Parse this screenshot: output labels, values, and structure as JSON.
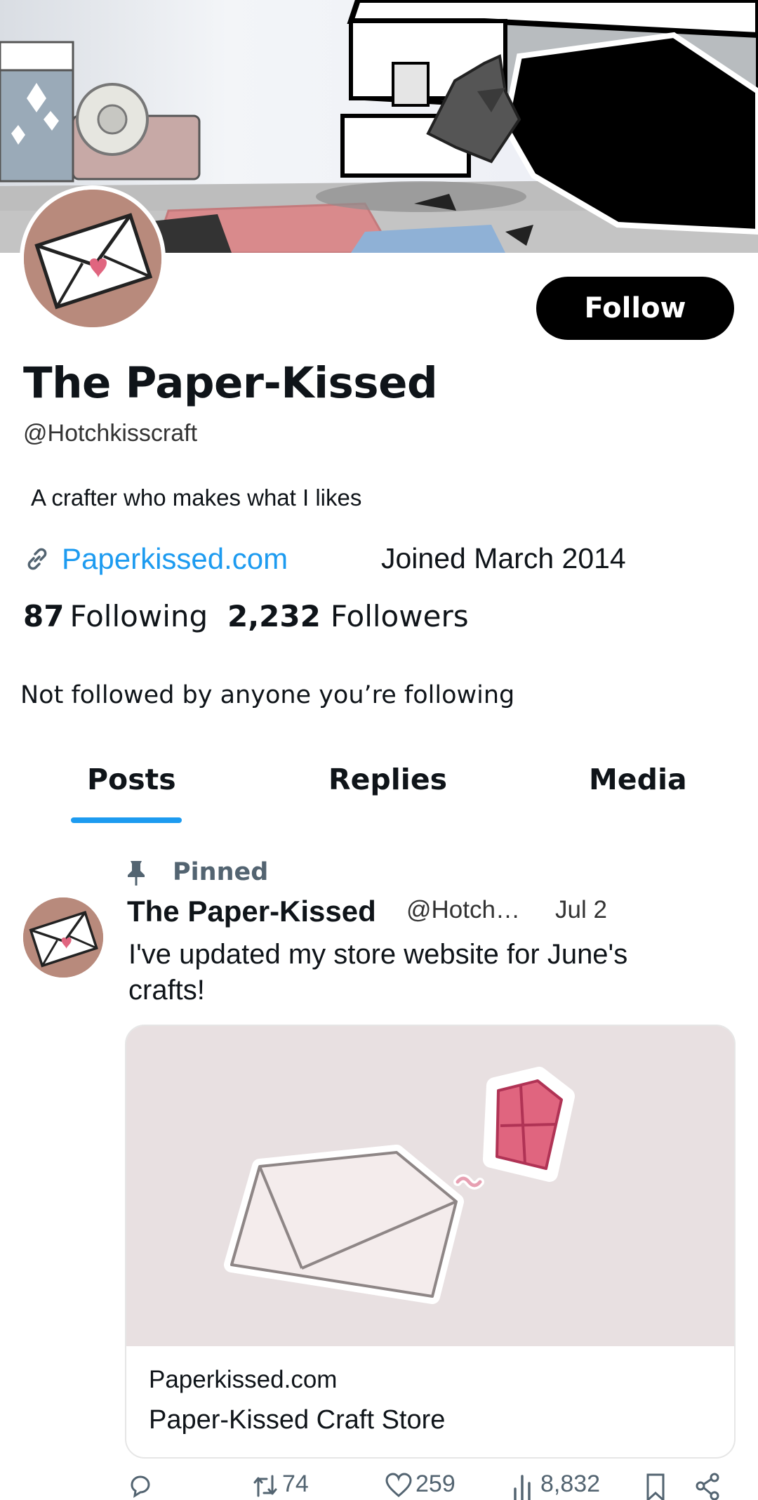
{
  "profile": {
    "display_name": "The Paper-Kissed",
    "handle": "@Hotchkisscraft",
    "bio": "A crafter who makes what I likes",
    "website": "Paperkissed.com",
    "joined": "Joined March 2014",
    "following_count": "87",
    "following_label": "Following",
    "followers_count": "2,232",
    "followers_label": "Followers",
    "followers_note": "Not followed by anyone you’re following",
    "follow_button": "Follow"
  },
  "tabs": [
    {
      "label": "Posts",
      "active": true
    },
    {
      "label": "Replies",
      "active": false
    },
    {
      "label": "Media",
      "active": false
    }
  ],
  "pinned_post": {
    "pinned_label": "Pinned",
    "author_name": "The Paper-Kissed",
    "author_handle": "@Hotch…",
    "date": "Jul 2",
    "text": "I've updated my store website for June's crafts!",
    "card": {
      "domain": "Paperkissed.com",
      "title": "Paper-Kissed Craft Store"
    },
    "actions": {
      "replies": "",
      "reposts": "74",
      "likes": "259",
      "views": "8,832"
    }
  },
  "colors": {
    "accent": "#1d9bf0",
    "follow_button_bg": "#000000",
    "secondary_text": "#536471",
    "avatar_bg": "#b88a7c",
    "heart_pink": "#e0657f"
  },
  "icons": {
    "website": "link-icon",
    "pinned": "pin-icon",
    "reply": "reply-icon",
    "repost": "repost-icon",
    "like": "heart-icon",
    "views": "views-icon",
    "bookmark": "bookmark-icon",
    "share": "share-icon"
  }
}
